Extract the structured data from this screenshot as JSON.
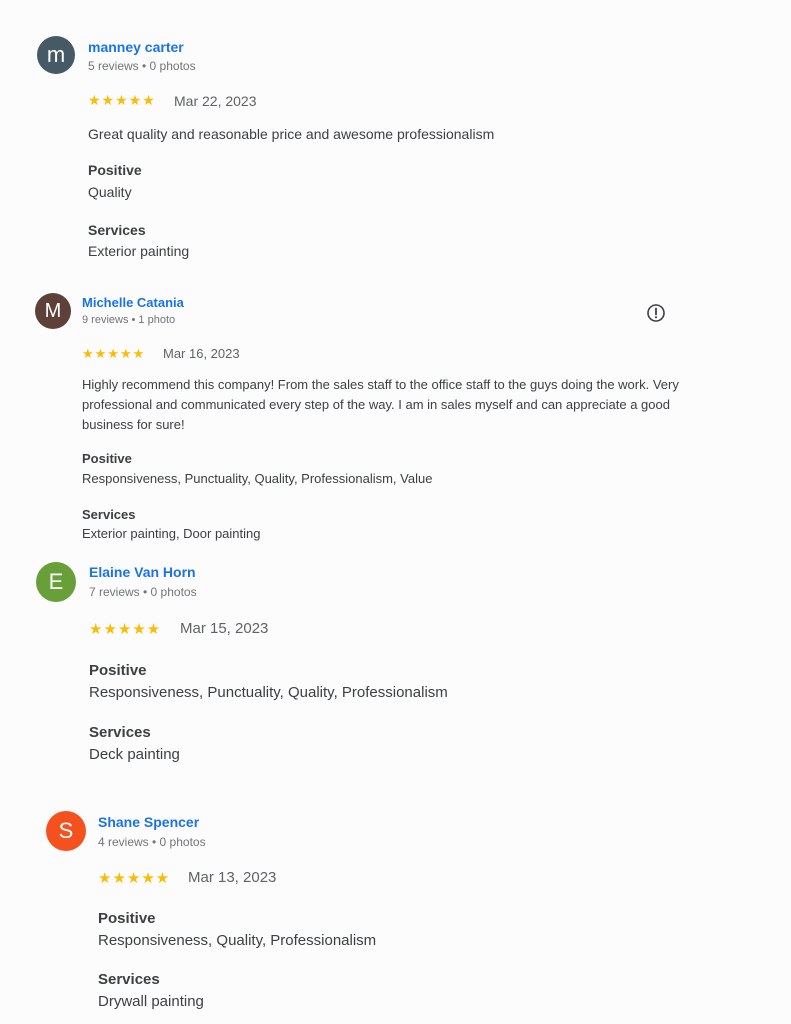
{
  "reviews": [
    {
      "avatar_letter": "m",
      "avatar_color": "#455a64",
      "name": "manney carter",
      "meta": "5 reviews • 0 photos",
      "stars": "★★★★★",
      "rating": 5,
      "date": "Mar 22, 2023",
      "text": "Great quality and reasonable price and awesome professionalism",
      "positive_label": "Positive",
      "positive_value": "Quality",
      "services_label": "Services",
      "services_value": "Exterior painting"
    },
    {
      "avatar_letter": "M",
      "avatar_color": "#5d4037",
      "name": "Michelle Catania",
      "meta": "9 reviews • 1 photo",
      "stars": "★★★★★",
      "rating": 5,
      "date": "Mar 16, 2023",
      "text": "Highly recommend this company! From the sales staff to the office staff to the guys doing the work. Very professional and communicated every step of the way. I am in sales myself and can appreciate a good business for sure!",
      "positive_label": "Positive",
      "positive_value": "Responsiveness, Punctuality, Quality, Professionalism, Value",
      "services_label": "Services",
      "services_value": "Exterior painting, Door painting",
      "flag_icon": "report-flag-icon"
    },
    {
      "avatar_letter": "E",
      "avatar_color": "#689f38",
      "name": "Elaine Van Horn",
      "meta": "7 reviews • 0 photos",
      "stars": "★★★★★",
      "rating": 5,
      "date": "Mar 15, 2023",
      "positive_label": "Positive",
      "positive_value": "Responsiveness, Punctuality, Quality, Professionalism",
      "services_label": "Services",
      "services_value": "Deck painting"
    },
    {
      "avatar_letter": "S",
      "avatar_color": "#f4511e",
      "name": "Shane Spencer",
      "meta": "4 reviews • 0 photos",
      "stars": "★★★★★",
      "rating": 5,
      "date": "Mar 13, 2023",
      "positive_label": "Positive",
      "positive_value": "Responsiveness, Quality, Professionalism",
      "services_label": "Services",
      "services_value": "Drywall painting"
    }
  ]
}
